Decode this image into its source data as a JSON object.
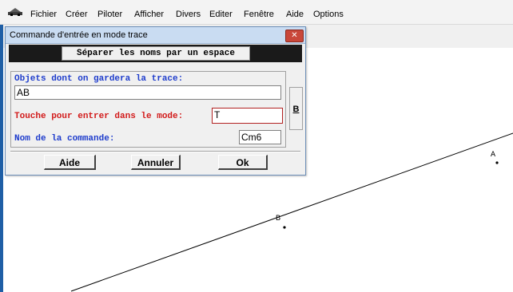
{
  "menubar": {
    "items": [
      "Fichier",
      "Créer",
      "Piloter",
      "Afficher",
      "Divers",
      "Editer",
      "Fenêtre",
      "Aide",
      "Options"
    ]
  },
  "dialog": {
    "title": "Commande d'entrée en mode trace",
    "close_label": "✕",
    "instruction": "Séparer les noms par un espace",
    "objects_label": "Objets dont on gardera la trace:",
    "objects_value": "AB",
    "key_label": "Touche pour entrer dans le mode:",
    "key_value": "T",
    "command_label": "Nom de la commande:",
    "command_value": "Cm6",
    "side_button_label": "B",
    "buttons": {
      "help": "Aide",
      "cancel": "Annuler",
      "ok": "Ok"
    }
  },
  "canvas": {
    "points": [
      {
        "name": "A"
      },
      {
        "name": "B"
      }
    ]
  },
  "colors": {
    "blue_label": "#1e3ccc",
    "red_label": "#d21a1a",
    "close_button": "#c9473a"
  }
}
